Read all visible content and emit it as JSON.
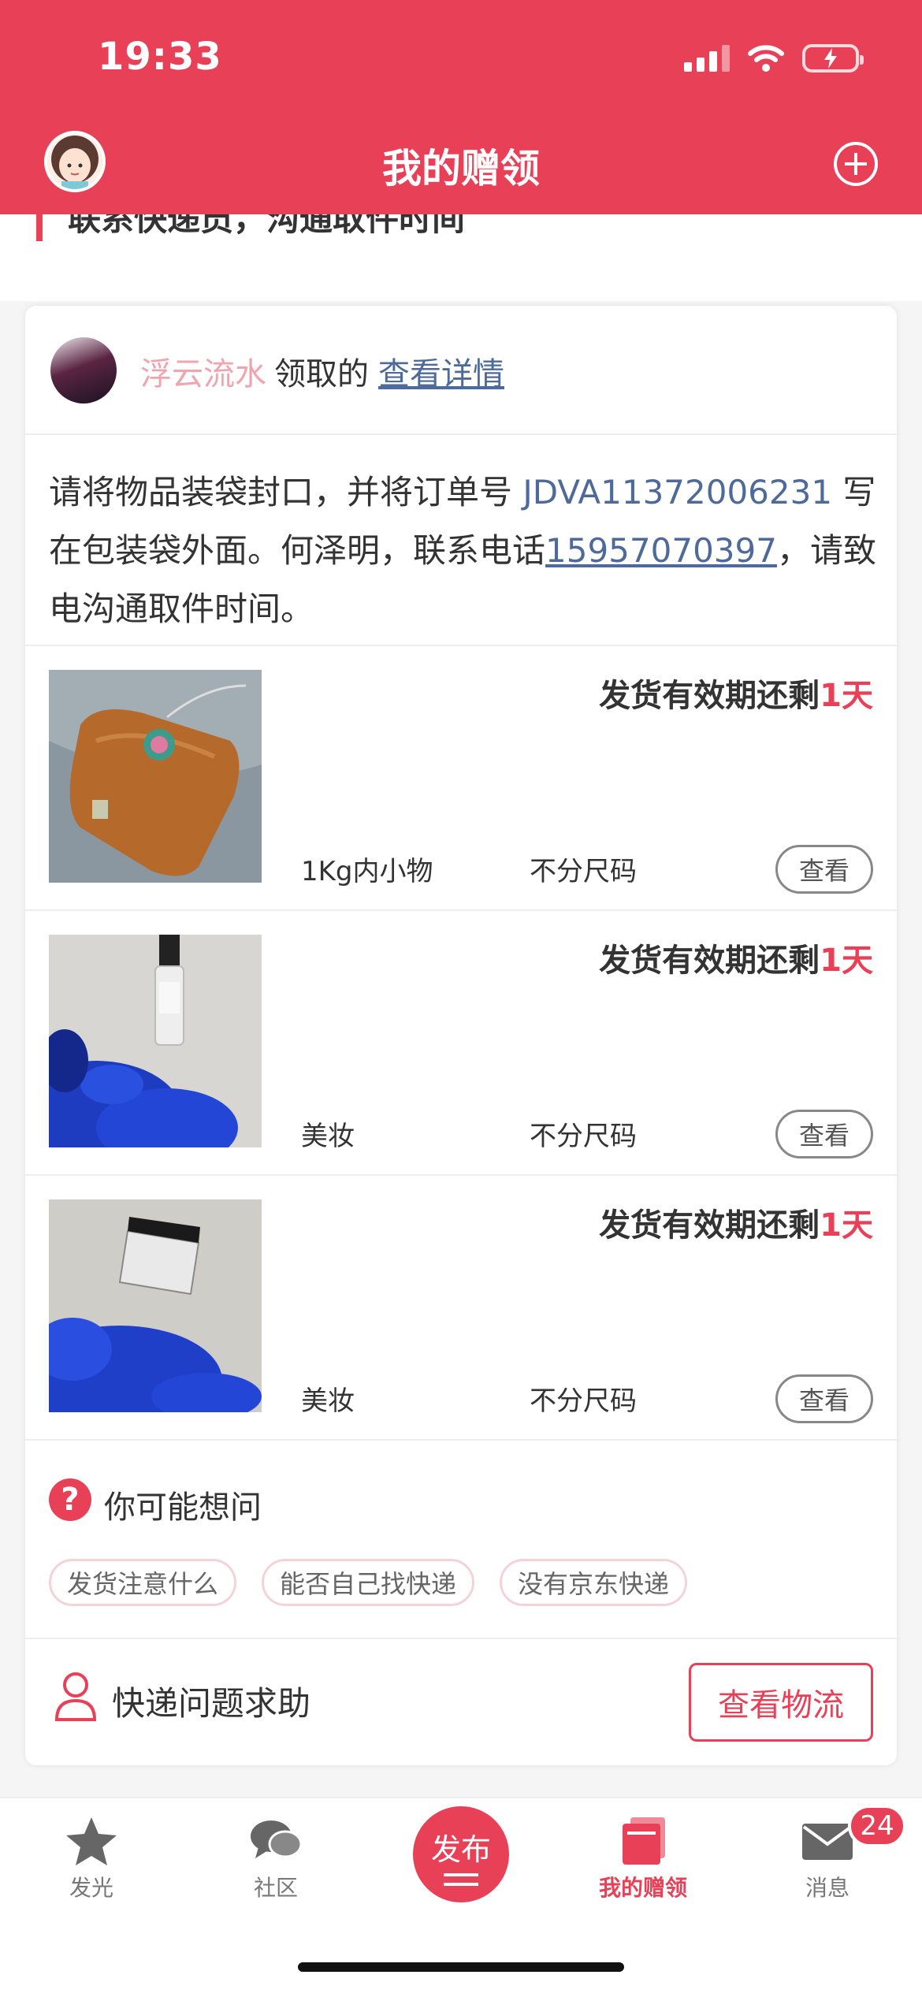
{
  "status_bar": {
    "time": "19:33"
  },
  "nav": {
    "title": "我的赠领"
  },
  "peek": {
    "text": "联系快递员，沟通取件时间"
  },
  "claim": {
    "name": "浮云流水",
    "verb": "领取的",
    "link": "查看详情",
    "instr_1": "请将物品装袋封口，并将订单号 ",
    "order_no": "JDVA11372006231",
    "instr_2": " 写在包装袋外面。何泽明，联系电话",
    "phone": "15957070397",
    "instr_3": "，请致电沟通取件时间。"
  },
  "items": [
    {
      "deadline_prefix": "发货有效期还剩",
      "deadline_days": "1天",
      "category": "1Kg内小物",
      "size": "不分尺码",
      "view": "查看",
      "image": "orange-hot-water-bag"
    },
    {
      "deadline_prefix": "发货有效期还剩",
      "deadline_days": "1天",
      "category": "美妆",
      "size": "不分尺码",
      "view": "查看",
      "image": "perfume-bottle-blue-fur"
    },
    {
      "deadline_prefix": "发货有效期还剩",
      "deadline_days": "1天",
      "category": "美妆",
      "size": "不分尺码",
      "view": "查看",
      "image": "cream-jar-blue-fur"
    }
  ],
  "faq": {
    "title": "你可能想问",
    "icon": "?",
    "tags": [
      "发货注意什么",
      "能否自己找快递",
      "没有京东快递"
    ]
  },
  "help": {
    "text": "快递问题求助",
    "button": "查看物流"
  },
  "tabbar": {
    "tabs": [
      {
        "label": "发光",
        "icon": "star-icon"
      },
      {
        "label": "社区",
        "icon": "chat-bubbles-icon"
      },
      {
        "label": "我的赠领",
        "icon": "gift-cards-icon"
      },
      {
        "label": "消息",
        "icon": "envelope-icon"
      }
    ],
    "publish": "发布",
    "badge": "24"
  },
  "colors": {
    "brand": "#e84057",
    "link": "#4e6a9a",
    "claimer_name": "#f0a4b0"
  }
}
